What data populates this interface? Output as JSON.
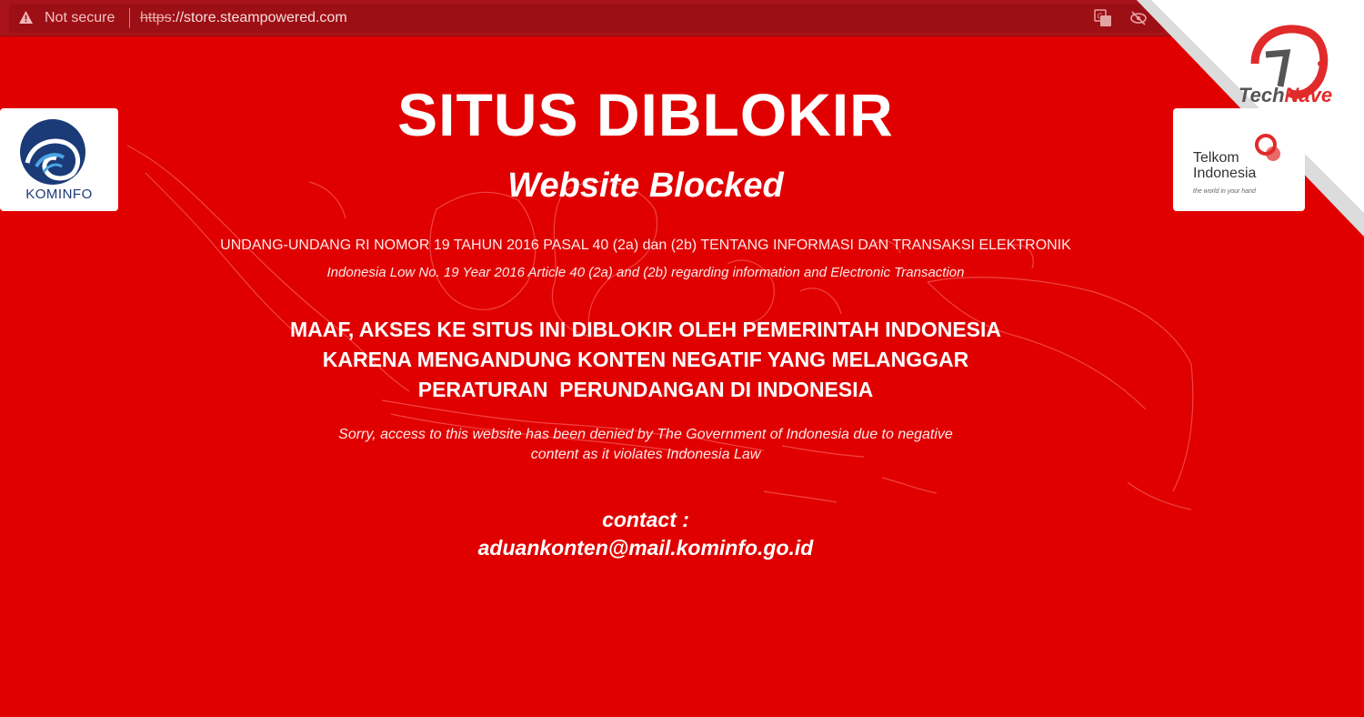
{
  "browser": {
    "security_label": "Not secure",
    "url_scheme": "https",
    "url_rest": "://store.steampowered.com",
    "icons": [
      "warning-icon",
      "translate-icon",
      "eye-off-icon"
    ]
  },
  "watermark": {
    "text_a": "Tech",
    "text_b": "Nave"
  },
  "logos": {
    "left": "KOMINFO",
    "right_line1": "Telkom",
    "right_line2": "Indonesia",
    "right_tagline": "the world in your hand"
  },
  "page": {
    "title": "SITUS DIBLOKIR",
    "subtitle": "Website Blocked",
    "law_id": "UNDANG-UNDANG RI NOMOR 19 TAHUN 2016 PASAL 40 (2a) dan (2b) TENTANG INFORMASI DAN TRANSAKSI ELEKTRONIK",
    "law_en": "Indonesia Low No. 19 Year 2016 Article 40 (2a) and (2b) regarding information and Electronic Transaction",
    "message_line1": "MAAF, AKSES KE SITUS INI DIBLOKIR OLEH PEMERINTAH INDONESIA",
    "message_line2": "KARENA MENGANDUNG KONTEN NEGATIF YANG MELANGGAR",
    "message_line3": "PERATURAN  PERUNDANGAN DI INDONESIA",
    "sorry_line1": "Sorry, access to this website has been denied by The Government of Indonesia due to negative",
    "sorry_line2": "content as it violates Indonesia Law",
    "contact_label": "contact :",
    "contact_email": "aduankonten@mail.kominfo.go.id"
  },
  "colors": {
    "background": "#e00000",
    "addressbar": "#a8141a",
    "text": "#ffffff"
  }
}
